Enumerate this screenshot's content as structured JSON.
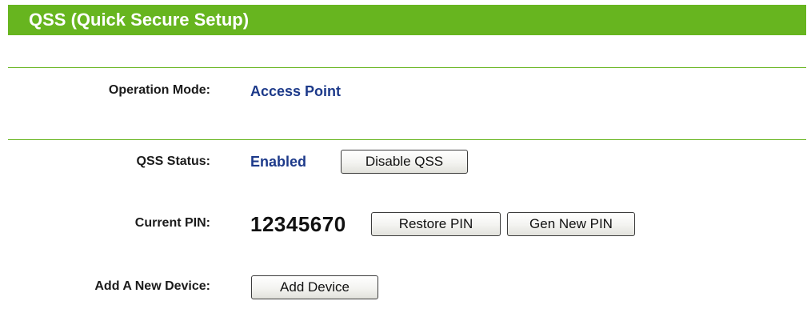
{
  "header": {
    "title": "QSS (Quick Secure Setup)"
  },
  "operation_mode": {
    "label": "Operation Mode:",
    "value": "Access Point"
  },
  "qss_status": {
    "label": "QSS Status:",
    "value": "Enabled",
    "disable_button": "Disable QSS"
  },
  "current_pin": {
    "label": "Current PIN:",
    "value": "12345670",
    "restore_button": "Restore PIN",
    "gen_button": "Gen New PIN"
  },
  "add_device": {
    "label": "Add A New Device:",
    "button": "Add Device"
  },
  "colors": {
    "header_bg": "#67b51f",
    "divider": "#67b51f",
    "value_blue": "#1d3a8a"
  }
}
